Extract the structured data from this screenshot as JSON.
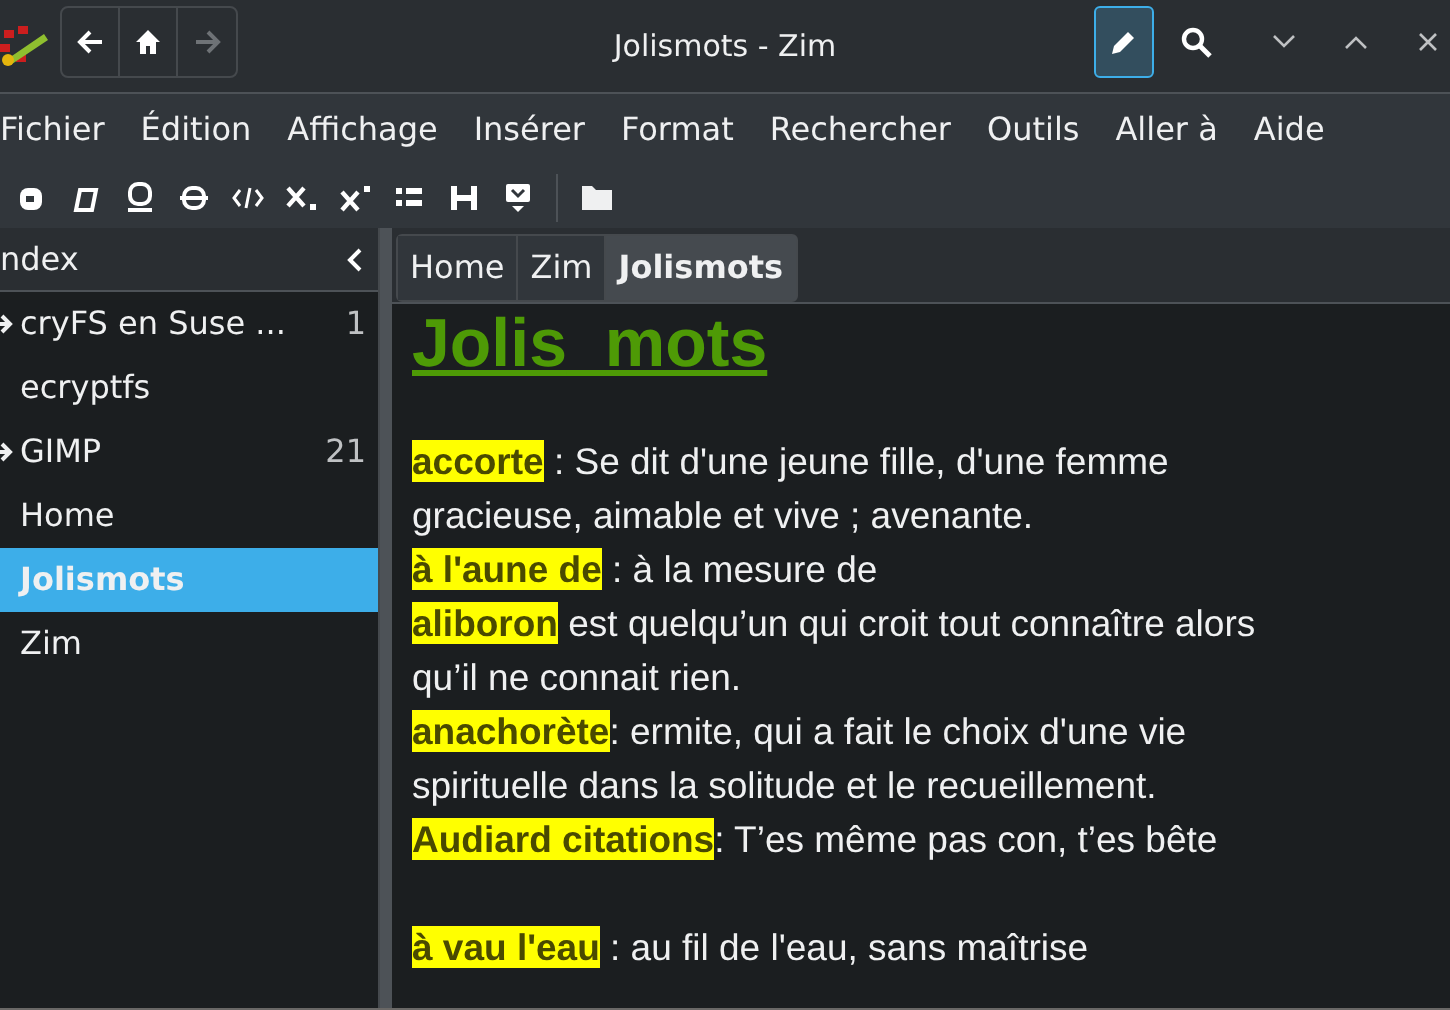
{
  "window": {
    "title": "Jolismots - Zim",
    "edit_mode": true
  },
  "menu": [
    "Fichier",
    "Édition",
    "Affichage",
    "Insérer",
    "Format",
    "Rechercher",
    "Outils",
    "Aller à",
    "Aide"
  ],
  "sidebar": {
    "title": "ndex",
    "items": [
      {
        "label": "cryFS en Suse ...",
        "count": "1",
        "expandable": true,
        "selected": false
      },
      {
        "label": "ecryptfs",
        "expandable": false,
        "selected": false
      },
      {
        "label": "GIMP",
        "count": "21",
        "expandable": true,
        "selected": false
      },
      {
        "label": "Home",
        "expandable": false,
        "selected": false
      },
      {
        "label": "Jolismots",
        "expandable": false,
        "selected": true
      },
      {
        "label": "Zim",
        "expandable": false,
        "selected": false
      }
    ]
  },
  "breadcrumbs": [
    {
      "label": "Home",
      "selected": false
    },
    {
      "label": "Zim",
      "selected": false
    },
    {
      "label": "Jolismots",
      "selected": true
    }
  ],
  "page": {
    "heading": "Jolis_mots",
    "entries": [
      {
        "term": "accorte",
        "definition": " : Se dit d'une jeune fille, d'une femme gracieuse, aimable et vive ; avenante."
      },
      {
        "term": "à l'aune de",
        "definition": " : à la mesure de"
      },
      {
        "term": "aliboron",
        "definition": " est quelqu’un qui croit tout connaître alors qu’il ne connait rien."
      },
      {
        "term": "anachorète",
        "definition": ": ermite, qui a fait le choix d'une vie spirituelle dans la solitude et le recueillement."
      },
      {
        "term": "Audiard citations",
        "definition": ": T’es même pas con, t’es bête"
      },
      {
        "term": "à vau l'eau",
        "definition": " : au fil de l'eau, sans maîtrise"
      }
    ]
  }
}
